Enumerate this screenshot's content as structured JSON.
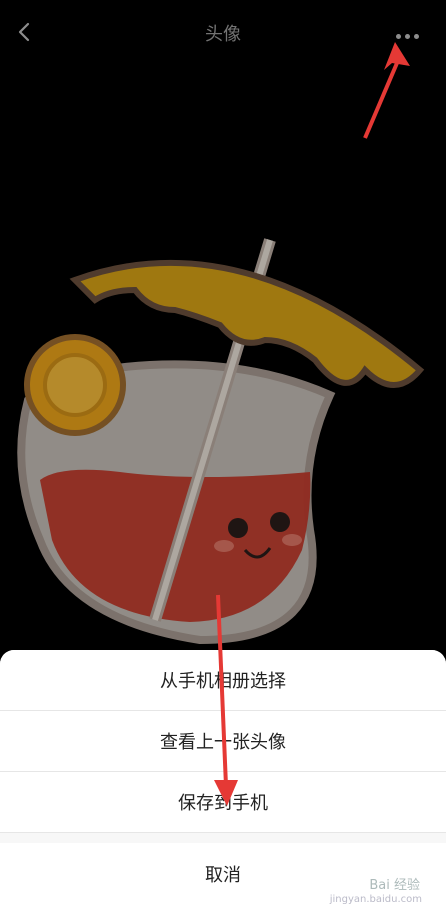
{
  "header": {
    "title": "头像",
    "back_icon": "chevron-left-icon",
    "more_icon": "more-horizontal-icon"
  },
  "sheet": {
    "options": [
      {
        "label": "从手机相册选择"
      },
      {
        "label": "查看上一张头像"
      },
      {
        "label": "保存到手机"
      }
    ],
    "cancel_label": "取消"
  },
  "watermark": {
    "text": "Bai 经验",
    "subtext": "jingyan.baidu.com"
  },
  "colors": {
    "background": "#000000",
    "annotation_arrow": "#e53935",
    "sheet_bg": "#ffffff"
  }
}
